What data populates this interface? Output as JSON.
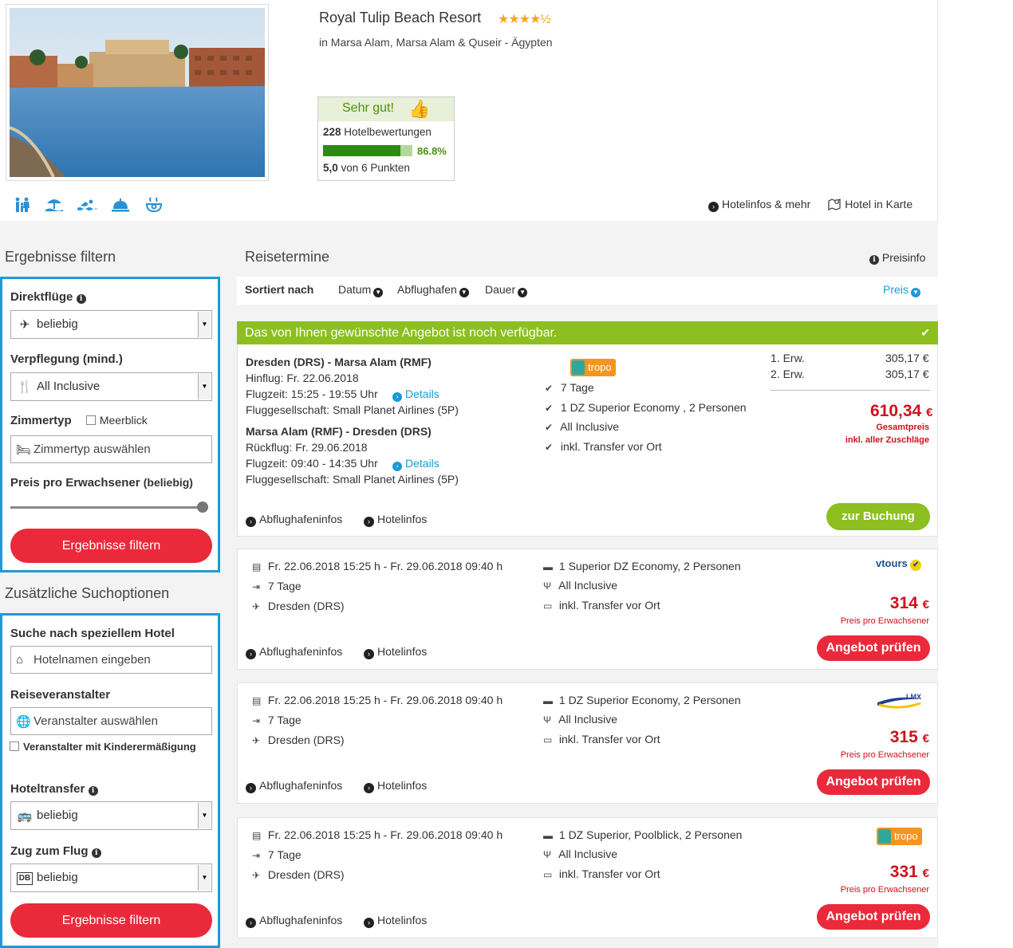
{
  "hotel": {
    "name": "Royal Tulip Beach Resort",
    "stars": "★★★★½",
    "location": "in Marsa Alam, Marsa Alam & Quseir - Ägypten"
  },
  "rating": {
    "label": "Sehr gut!",
    "count": "228",
    "count_label": "Hotelbewertungen",
    "percent": "86.8%",
    "percent_value": 86.8,
    "score": "5,0",
    "score_label": "von 6 Punkten"
  },
  "amenities": [
    "family-icon",
    "beach-icon",
    "pool-icon",
    "service-bell-icon",
    "spa-icon"
  ],
  "header_links": {
    "hotelinfos": "Hotelinfos & mehr",
    "map": "Hotel in Karte"
  },
  "filter": {
    "title": "Ergebnisse filtern",
    "direct_label": "Direktflüge",
    "direct_value": "beliebig",
    "board_label": "Verpflegung (mind.)",
    "board_value": "All Inclusive",
    "room_label": "Zimmertyp",
    "seaview_label": "Meerblick",
    "room_placeholder": "Zimmertyp auswählen",
    "price_label": "Preis pro Erwachsener",
    "price_hint": "(beliebig)",
    "button": "Ergebnisse filtern"
  },
  "extra": {
    "title": "Zusätzliche Suchoptionen",
    "hotel_search_label": "Suche nach speziellem Hotel",
    "hotel_search_placeholder": "Hotelnamen eingeben",
    "operator_label": "Reiseveranstalter",
    "operator_placeholder": "Veranstalter auswählen",
    "child_discount_label": "Veranstalter mit Kinderermäßigung",
    "transfer_label": "Hoteltransfer",
    "transfer_value": "beliebig",
    "train_label": "Zug zum Flug",
    "train_value": "beliebig",
    "button": "Ergebnisse filtern"
  },
  "main": {
    "title": "Reisetermine",
    "preisinfo": "Preisinfo",
    "sorted_by": "Sortiert nach",
    "sort_date": "Datum",
    "sort_airport": "Abflughafen",
    "sort_duration": "Dauer",
    "sort_price": "Preis"
  },
  "featured": {
    "banner": "Das von Ihnen gewünschte Angebot ist noch verfügbar.",
    "out_route": "Dresden (DRS) - Marsa Alam (RMF)",
    "out_date": "Hinflug: Fr. 22.06.2018",
    "out_time": "Flugzeit: 15:25 - 19:55 Uhr",
    "out_airline": "Fluggesellschaft: Small Planet Airlines (5P)",
    "ret_route": "Marsa Alam (RMF) - Dresden (DRS)",
    "ret_date": "Rückflug: Fr. 29.06.2018",
    "ret_time": "Flugzeit: 09:40 - 14:35 Uhr",
    "ret_airline": "Fluggesellschaft: Small Planet Airlines (5P)",
    "details": "Details",
    "operator": "tropo",
    "feature_1": "7 Tage",
    "feature_2": "1 DZ Superior Economy , 2 Personen",
    "feature_3": "All Inclusive",
    "feature_4": "inkl. Transfer vor Ort",
    "adult1_label": "1. Erw.",
    "adult1_price": "305,17 €",
    "adult2_label": "2. Erw.",
    "adult2_price": "305,17 €",
    "total": "610,34",
    "currency": "€",
    "total_label": "Gesamtpreis",
    "total_sub": "inkl. aller Zuschläge",
    "airport_info": "Abflughafeninfos",
    "hotel_info": "Hotelinfos",
    "book": "zur Buchung"
  },
  "offers": [
    {
      "dates": "Fr. 22.06.2018 15:25 h - Fr. 29.06.2018 09:40 h",
      "duration": "7 Tage",
      "airport": "Dresden (DRS)",
      "room": "1 Superior DZ Economy, 2 Personen",
      "board": "All Inclusive",
      "transfer": "inkl. Transfer vor Ort",
      "operator": "vtours",
      "price": "314",
      "currency": "€",
      "price_label": "Preis pro Erwachsener",
      "airport_info": "Abflughafeninfos",
      "hotel_info": "Hotelinfos",
      "button": "Angebot prüfen"
    },
    {
      "dates": "Fr. 22.06.2018 15:25 h - Fr. 29.06.2018 09:40 h",
      "duration": "7 Tage",
      "airport": "Dresden (DRS)",
      "room": "1 DZ Superior Economy, 2 Personen",
      "board": "All Inclusive",
      "transfer": "inkl. Transfer vor Ort",
      "operator": "LMX Touristik",
      "price": "315",
      "currency": "€",
      "price_label": "Preis pro Erwachsener",
      "airport_info": "Abflughafeninfos",
      "hotel_info": "Hotelinfos",
      "button": "Angebot prüfen"
    },
    {
      "dates": "Fr. 22.06.2018 15:25 h - Fr. 29.06.2018 09:40 h",
      "duration": "7 Tage",
      "airport": "Dresden (DRS)",
      "room": "1 DZ Superior, Poolblick, 2 Personen",
      "board": "All Inclusive",
      "transfer": "inkl. Transfer vor Ort",
      "operator": "tropo",
      "price": "331",
      "currency": "€",
      "price_label": "Preis pro Erwachsener",
      "airport_info": "Abflughafeninfos",
      "hotel_info": "Hotelinfos",
      "button": "Angebot prüfen"
    }
  ]
}
